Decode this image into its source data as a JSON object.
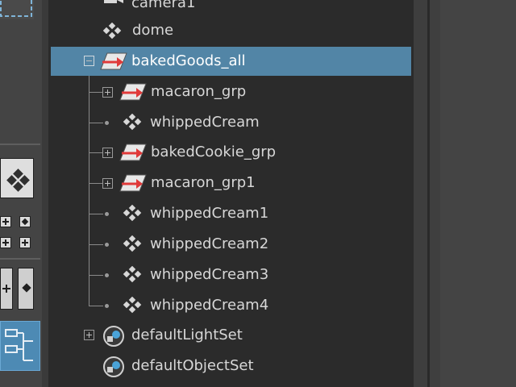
{
  "outliner": {
    "items": [
      {
        "label": "camera1",
        "icon": "camera-icon",
        "expander": "none"
      },
      {
        "label": "dome",
        "icon": "mesh-icon",
        "expander": "none"
      },
      {
        "label": "bakedGoods_all",
        "icon": "group-icon",
        "expander": "minus",
        "selected": true
      },
      {
        "label": "macaron_grp",
        "icon": "group-icon",
        "expander": "plus"
      },
      {
        "label": "whippedCream",
        "icon": "mesh-icon",
        "expander": "dot"
      },
      {
        "label": "bakedCookie_grp",
        "icon": "group-icon",
        "expander": "plus"
      },
      {
        "label": "macaron_grp1",
        "icon": "group-icon",
        "expander": "plus"
      },
      {
        "label": "whippedCream1",
        "icon": "mesh-icon",
        "expander": "dot"
      },
      {
        "label": "whippedCream2",
        "icon": "mesh-icon",
        "expander": "dot"
      },
      {
        "label": "whippedCream3",
        "icon": "mesh-icon",
        "expander": "dot"
      },
      {
        "label": "whippedCream4",
        "icon": "mesh-icon",
        "expander": "dot"
      },
      {
        "label": "defaultLightSet",
        "icon": "set-icon",
        "expander": "plus"
      },
      {
        "label": "defaultObjectSet",
        "icon": "set-icon",
        "expander": "none"
      }
    ]
  },
  "colors": {
    "selection": "#5285a6",
    "panel_bg": "#2b2b2b",
    "text": "#d7d7d7",
    "group_arrow": "#e03a3a"
  }
}
